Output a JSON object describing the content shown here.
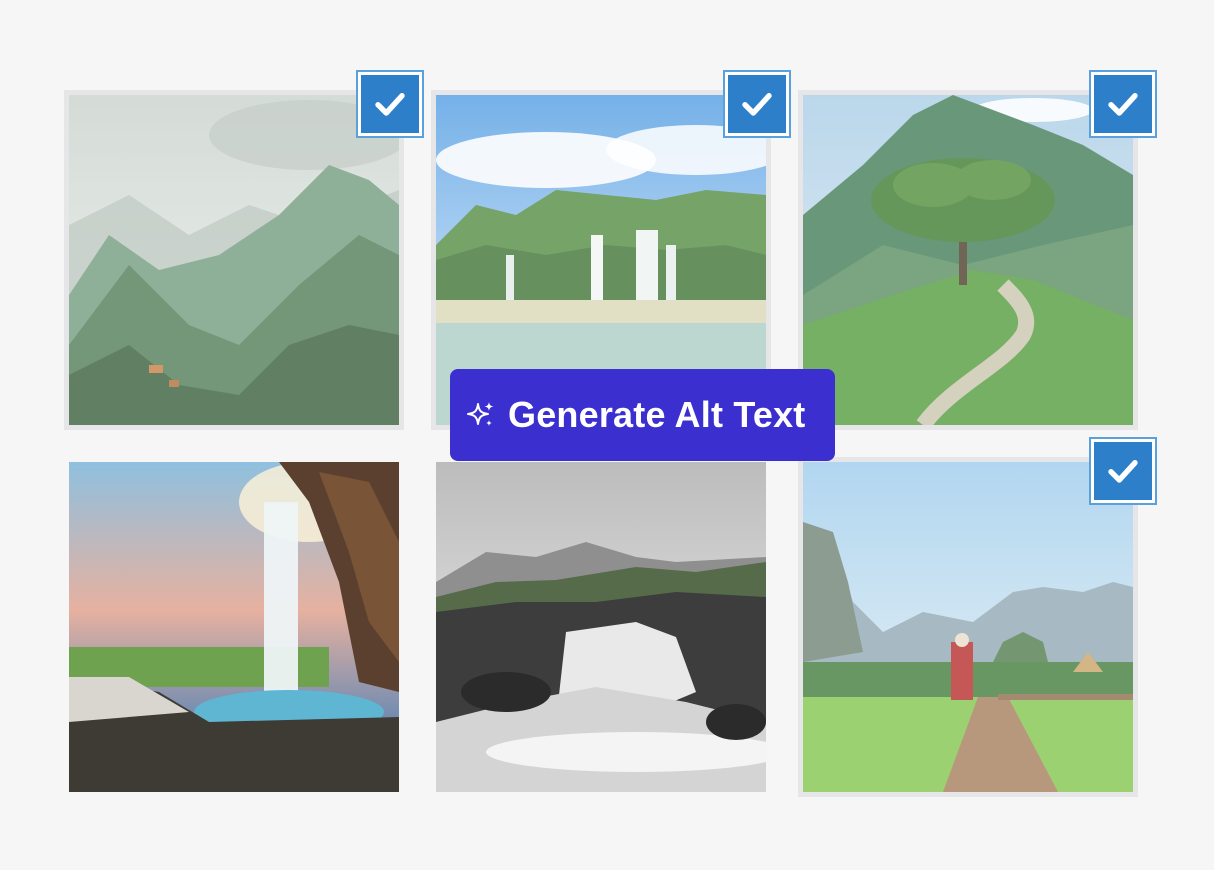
{
  "action_button": {
    "label": "Generate Alt Text",
    "icon": "sparkles-icon",
    "background": "#3b2fd0",
    "text_color": "#ffffff"
  },
  "checkbox": {
    "icon": "checkmark-icon",
    "color": "#2d7fc9"
  },
  "gallery": {
    "items": [
      {
        "scene": "misty green mountains",
        "selected": true
      },
      {
        "scene": "tropical waterfalls over lake",
        "selected": true
      },
      {
        "scene": "lone tree on hill with path",
        "selected": true
      },
      {
        "scene": "waterfall from cliff at sunset",
        "selected": false
      },
      {
        "scene": "black and white cascading waterfall",
        "selected": false
      },
      {
        "scene": "woman on boardwalk through rice field",
        "selected": true
      }
    ]
  }
}
